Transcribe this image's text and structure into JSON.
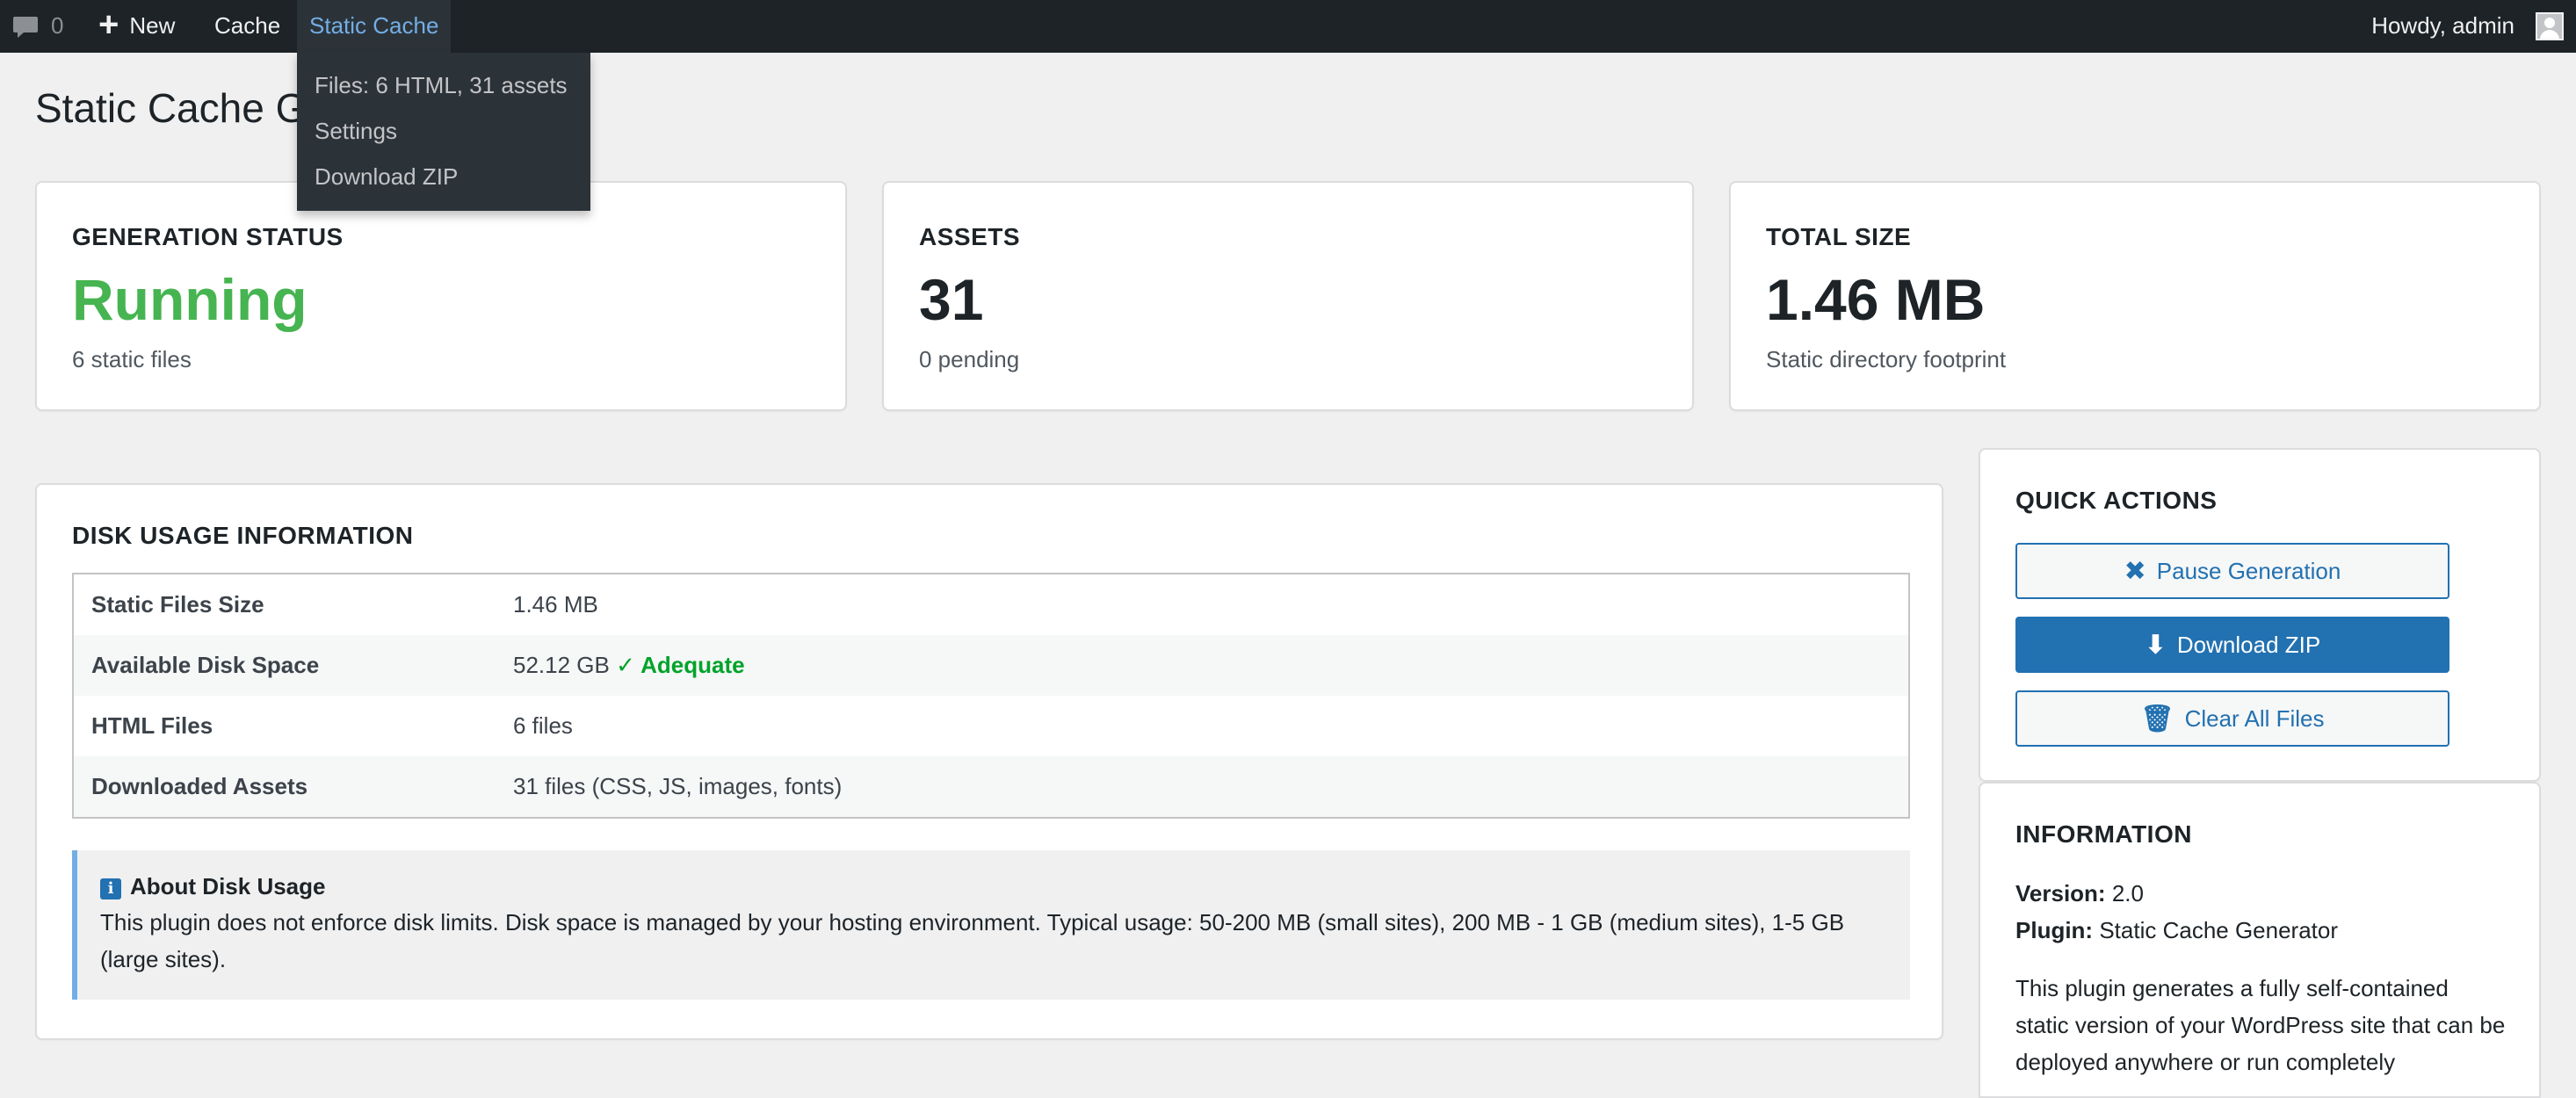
{
  "adminbar": {
    "comments_count": "0",
    "new_label": "New",
    "cache_label": "Cache",
    "static_cache_label": "Static Cache",
    "howdy": "Howdy, admin"
  },
  "dropdown": {
    "items": [
      "Files: 6 HTML, 31 assets",
      "Settings",
      "Download ZIP"
    ]
  },
  "page": {
    "title": "Static Cache G"
  },
  "stats": [
    {
      "title": "GENERATION STATUS",
      "value": "Running",
      "sub": "6 static files",
      "value_color": "#46b450"
    },
    {
      "title": "ASSETS",
      "value": "31",
      "sub": "0 pending"
    },
    {
      "title": "TOTAL SIZE",
      "value": "1.46 MB",
      "sub": "Static directory footprint"
    }
  ],
  "disk": {
    "title": "DISK USAGE INFORMATION",
    "rows": [
      {
        "label": "Static Files Size",
        "value": "1.46 MB"
      },
      {
        "label": "Available Disk Space",
        "value": "52.12 GB",
        "status": "✓ Adequate"
      },
      {
        "label": "HTML Files",
        "value": "6 files"
      },
      {
        "label": "Downloaded Assets",
        "value": "31 files (CSS, JS, images, fonts)"
      }
    ],
    "notice_title": "About Disk Usage",
    "notice_text": "This plugin does not enforce disk limits. Disk space is managed by your hosting environment. Typical usage: 50-200 MB (small sites), 200 MB - 1 GB (medium sites), 1-5 GB (large sites)."
  },
  "quick_actions": {
    "title": "QUICK ACTIONS",
    "pause": "Pause Generation",
    "download": "Download ZIP",
    "clear": "Clear All Files"
  },
  "information": {
    "title": "INFORMATION",
    "version_label": "Version:",
    "version": "2.0",
    "plugin_label": "Plugin:",
    "plugin": "Static Cache Generator",
    "description": "This plugin generates a fully self-contained static version of your WordPress site that can be deployed anywhere or run completely"
  },
  "colors": {
    "accent": "#2271b1",
    "success": "#00a32a",
    "adminbar": "#1d2327"
  }
}
